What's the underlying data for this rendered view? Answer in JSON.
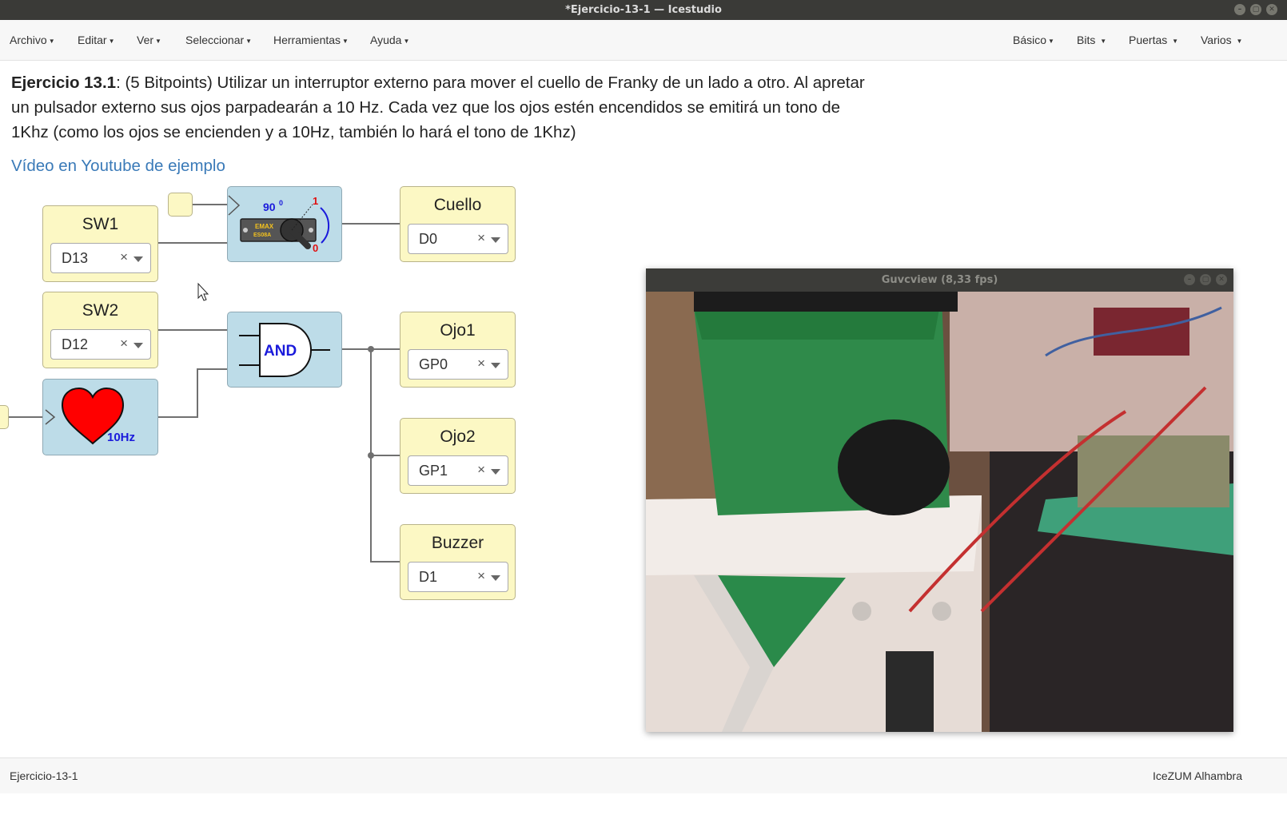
{
  "window": {
    "title": "*Ejercicio-13-1 — Icestudio"
  },
  "menubar": {
    "left": [
      "Archivo",
      "Editar",
      "Ver",
      "Seleccionar",
      "Herramientas",
      "Ayuda"
    ],
    "right": [
      "Básico",
      "Bits",
      "Puertas",
      "Varios"
    ]
  },
  "description": {
    "bold": "Ejercicio 13.1",
    "text": ": (5 Bitpoints) Utilizar un interruptor externo para mover el cuello de Franky de un lado a otro. Al apretar un pulsador externo sus ojos parpadearán a 10 Hz. Cada vez que los ojos estén encendidos se emitirá un tono de 1Khz (como los ojos se encienden y a 10Hz, también lo hará el tono de 1Khz)",
    "link": "Vídeo en Youtube de ejemplo"
  },
  "inputs": [
    {
      "name": "SW1",
      "pin": "D13"
    },
    {
      "name": "SW2",
      "pin": "D12"
    }
  ],
  "outputs": [
    {
      "name": "Cuello",
      "pin": "D0"
    },
    {
      "name": "Ojo1",
      "pin": "GP0"
    },
    {
      "name": "Ojo2",
      "pin": "GP1"
    },
    {
      "name": "Buzzer",
      "pin": "D1"
    }
  ],
  "blocks": {
    "servo": {
      "angle": "90",
      "degree_mark": "0",
      "top_label": "1",
      "bottom_label": "0",
      "brand": "EMAX",
      "model": "ES08A"
    },
    "and_gate": {
      "label": "AND"
    },
    "heart": {
      "label": "10Hz"
    }
  },
  "camera_window": {
    "title": "Guvcview  (8,33 fps)"
  },
  "statusbar": {
    "left": "Ejercicio-13-1",
    "right": "IceZUM Alhambra"
  },
  "colors": {
    "link": "#3a7ab8",
    "block_yellow": "#fcf8c4",
    "block_blue": "#bddce8",
    "heart_red": "#ff0000",
    "and_label": "#1a1adb"
  }
}
